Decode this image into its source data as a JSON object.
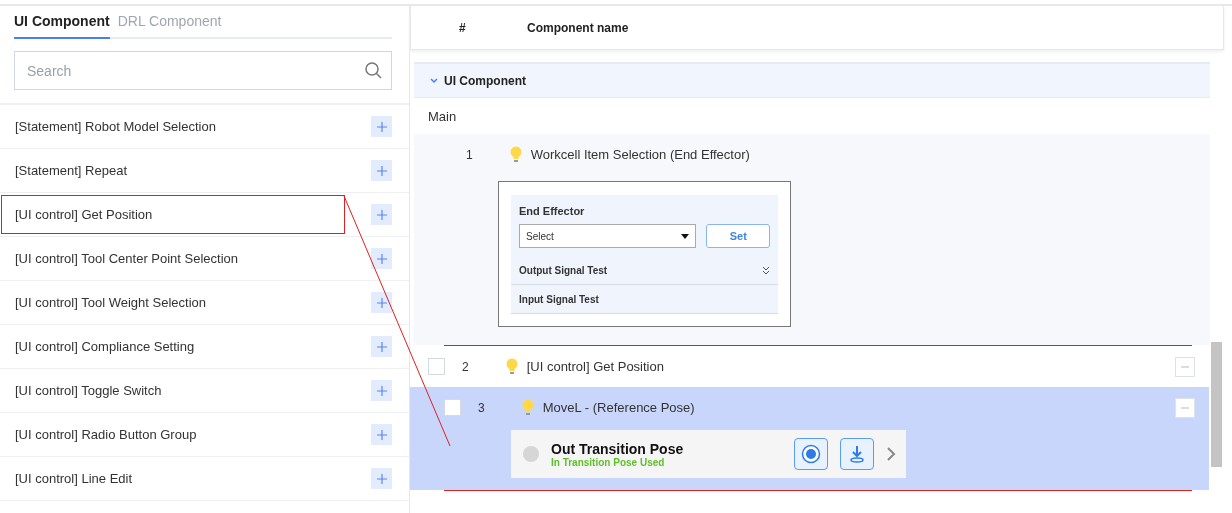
{
  "tabs": [
    {
      "label": "UI Component",
      "selected": true
    },
    {
      "label": "DRL Component",
      "selected": false
    }
  ],
  "search": {
    "placeholder": "Search"
  },
  "components": [
    {
      "label": "[Statement] Robot Model Selection",
      "highlighted": false
    },
    {
      "label": "[Statement] Repeat",
      "highlighted": false
    },
    {
      "label": "[UI control] Get Position",
      "highlighted": true
    },
    {
      "label": "[UI control] Tool Center Point Selection",
      "highlighted": false
    },
    {
      "label": "[UI control] Tool Weight Selection",
      "highlighted": false
    },
    {
      "label": "[UI control] Compliance Setting",
      "highlighted": false
    },
    {
      "label": "[UI control] Toggle Switch",
      "highlighted": false
    },
    {
      "label": "[UI control] Radio Button Group",
      "highlighted": false
    },
    {
      "label": "[UI control] Line Edit",
      "highlighted": false
    }
  ],
  "table": {
    "columns": [
      "#",
      "Component name"
    ],
    "section": {
      "title": "UI Component",
      "expanded": true
    },
    "group": "Main",
    "rows": [
      {
        "kind": "widget",
        "number": "1",
        "title": "Workcell Item Selection (End Effector)",
        "selected": false,
        "highlighted": false,
        "widget": {
          "heading": "End Effector",
          "select": "Select",
          "button": "Set",
          "sections": [
            {
              "label": "Output Signal Test",
              "expandable": true
            },
            {
              "label": "Input Signal Test",
              "expandable": false
            }
          ]
        }
      },
      {
        "kind": "plain",
        "number": "2",
        "title": "[UI control] Get Position",
        "selected": false,
        "checked": false,
        "highlighted": true
      },
      {
        "kind": "pose",
        "number": "3",
        "title": "MoveL - (Reference Pose)",
        "selected": true,
        "checked": false,
        "highlighted": true,
        "pose": {
          "title": "Out Transition Pose",
          "status": "In Transition Pose Used"
        }
      }
    ]
  }
}
